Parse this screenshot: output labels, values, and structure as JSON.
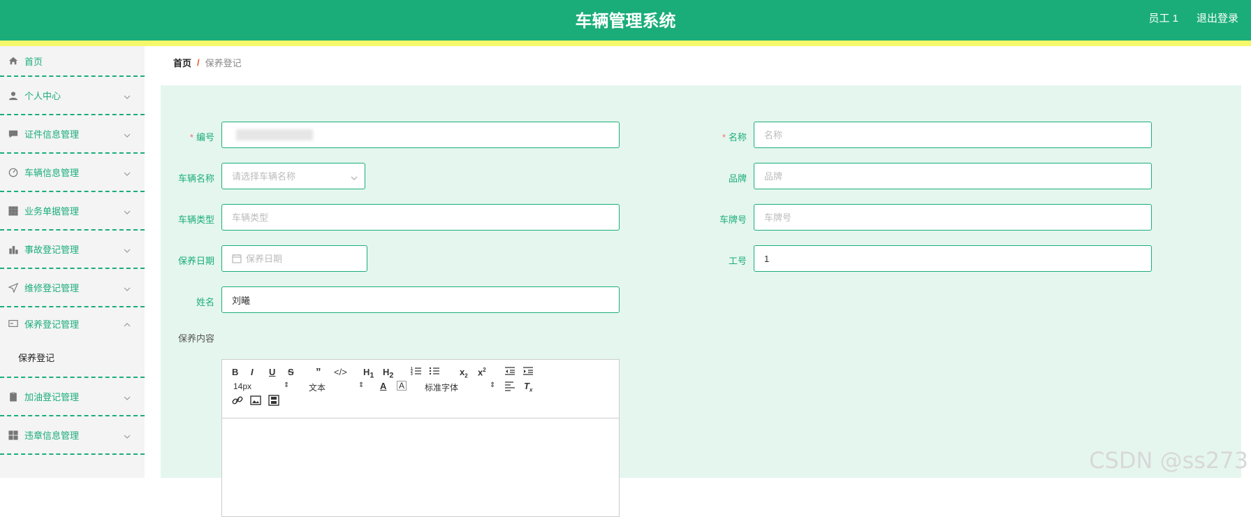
{
  "header": {
    "title": "车辆管理系统",
    "user": "员工 1",
    "logout": "退出登录"
  },
  "colors": {
    "primary": "#1aad7a",
    "accent_bar": "#f5f86a",
    "form_bg": "#e5f6ef",
    "required": "#f56c6c"
  },
  "sidebar": {
    "items": [
      {
        "label": "首页",
        "icon": "home-icon"
      },
      {
        "label": "个人中心",
        "icon": "user-icon"
      },
      {
        "label": "证件信息管理",
        "icon": "chat-icon"
      },
      {
        "label": "车辆信息管理",
        "icon": "speedometer-icon"
      },
      {
        "label": "业务单据管理",
        "icon": "grid-icon"
      },
      {
        "label": "事故登记管理",
        "icon": "bar-chart-icon"
      },
      {
        "label": "维修登记管理",
        "icon": "send-icon"
      },
      {
        "label": "保养登记管理",
        "icon": "card-icon"
      },
      {
        "label": "加油登记管理",
        "icon": "clipboard-icon"
      },
      {
        "label": "违章信息管理",
        "icon": "apps-icon"
      }
    ],
    "sub_item": "保养登记"
  },
  "breadcrumb": {
    "home": "首页",
    "separator": "/",
    "current": "保养登记"
  },
  "form": {
    "bianhao": {
      "label": "编号",
      "value": ""
    },
    "mingcheng": {
      "label": "名称",
      "placeholder": "名称"
    },
    "cheliangmingcheng": {
      "label": "车辆名称",
      "placeholder": "请选择车辆名称"
    },
    "pinpai": {
      "label": "品牌",
      "placeholder": "品牌"
    },
    "cheliangleixing": {
      "label": "车辆类型",
      "placeholder": "车辆类型"
    },
    "chepaihao": {
      "label": "车牌号",
      "placeholder": "车牌号"
    },
    "baoyangriqi": {
      "label": "保养日期",
      "placeholder": "保养日期"
    },
    "gonghao": {
      "label": "工号",
      "value": "1"
    },
    "xingming": {
      "label": "姓名",
      "value": "刘曦"
    },
    "baoyangneirong": {
      "label": "保养内容"
    }
  },
  "editor": {
    "font_size": "14px",
    "text_type": "文本",
    "font_family": "标准字体"
  },
  "watermark": "CSDN @ss273"
}
